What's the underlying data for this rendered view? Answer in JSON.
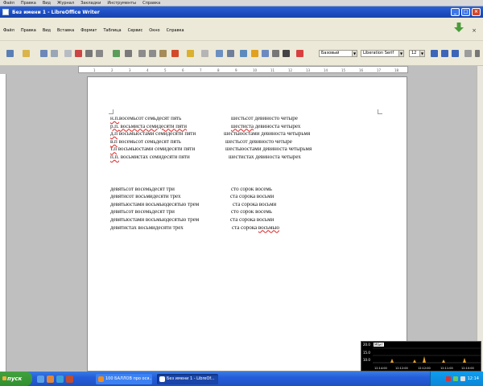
{
  "shell_menu": [
    "Файл",
    "Правка",
    "Вид",
    "Журнал",
    "Закладки",
    "Инструменты",
    "Справка"
  ],
  "window": {
    "title": "Без имени 1 - LibreOffice Writer"
  },
  "menu": [
    "Файл",
    "Правка",
    "Вид",
    "Вставка",
    "Формат",
    "Таблица",
    "Сервис",
    "Окно",
    "Справка"
  ],
  "toolbar": {
    "style": "Базовый",
    "font": "Liberation Serif",
    "size": "12"
  },
  "ruler": [
    "1",
    "2",
    "3",
    "4",
    "5",
    "6",
    "7",
    "8",
    "9",
    "10",
    "11",
    "12",
    "13",
    "14",
    "15",
    "16",
    "17",
    "18"
  ],
  "doc": {
    "block1": [
      {
        "a_prefix": "н.п.",
        "a": "восемьсот семьдесят пять",
        "b": "шестьсот девиносто четыре",
        "b_under": ""
      },
      {
        "a_prefix": "р.п.",
        "a": " восьмиста семидесяти пяти",
        "b": "шестиста",
        "b_rest": " девиноста четырех"
      },
      {
        "a_prefix": "д.п",
        "a": " восьмыостами семидесяти пяти",
        "b": "шестьюостами девиноста четырьмя",
        "b_under": ""
      },
      {
        "a_prefix": "в.п",
        "a": " восемьсот семьдесят пять",
        "b": "шестьсот девиносто четыре",
        "b_under": ""
      },
      {
        "a_prefix": "т.п",
        "a": " восьмыостами семидесяти пяти",
        "b": "шестьюостами девиноста четырьмя",
        "b_under": ""
      },
      {
        "a_prefix": "п.п.",
        "a": " восьмистах семидесяти пяти",
        "b": "шестистах девиноста четырех",
        "b_under": ""
      }
    ],
    "block2": [
      {
        "a": "девятьсот восемьдесят три",
        "b": "сто сорок восемь"
      },
      {
        "a": "девятисот восьмидесяти трех",
        "b": "ста сорока восьми"
      },
      {
        "a": "девятьюстами восьмьюдесятью трем",
        "b": "ста сорока восьми"
      },
      {
        "a": "девятьсот восемьдесят три",
        "b": "сто сорок восемь"
      },
      {
        "a": "девятьюстами восьмьюдесятью трем",
        "b": "ста сорока восьми"
      },
      {
        "a": "девятистах восьмидесяти трех",
        "b": "ста сорока ",
        "b_tail": "восьмью"
      }
    ]
  },
  "netmon": {
    "y_labels": [
      "20.0",
      "15.0",
      "10.0"
    ],
    "tag": "Мбит",
    "times": [
      "12:14:00",
      "12:12:00",
      "12:12:00",
      "12:11:00",
      "12:10:00"
    ]
  },
  "taskbar": {
    "start": "пуск",
    "tasks": [
      "100 БАЛЛОВ про ося...",
      "Без имени 1 - LibreOf..."
    ],
    "clock": "12:14"
  },
  "colors": {
    "titlebar": "#245edb",
    "taskbar": "#245edb",
    "start": "#308f2e",
    "page": "#ffffff",
    "misspell": "#dd2222"
  }
}
